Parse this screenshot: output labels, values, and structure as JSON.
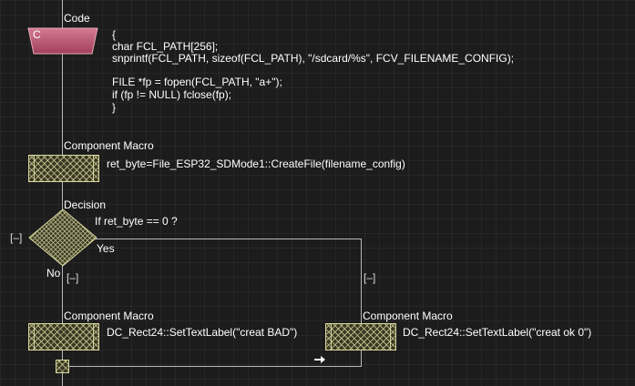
{
  "code_block": {
    "header": "Code",
    "icon_label": "C",
    "lines": [
      "{",
      "char FCL_PATH[256];",
      "snprintf(FCL_PATH, sizeof(FCL_PATH), \"/sdcard/%s\", FCV_FILENAME_CONFIG);",
      "",
      "FILE *fp = fopen(FCL_PATH, \"a+\");",
      "if (fp != NULL) fclose(fp);",
      "}"
    ]
  },
  "macro_create": {
    "header": "Component Macro",
    "call": "ret_byte=File_ESP32_SDMode1::CreateFile(filename_config)"
  },
  "decision": {
    "header": "Decision",
    "condition": "If  ret_byte == 0 ?",
    "yes_label": "Yes",
    "no_label": "No",
    "collapse_left": "[–]",
    "collapse_no": "[–]",
    "collapse_yes": "[–]"
  },
  "macro_bad": {
    "header": "Component Macro",
    "call": "DC_Rect24::SetTextLabel(\"creat BAD\")"
  },
  "macro_ok": {
    "header": "Component Macro",
    "call": "DC_Rect24::SetTextLabel(\"creat ok 0\")"
  },
  "colors": {
    "background": "#1c1c1c",
    "code_icon": "#b04a66",
    "hatch": "#d8d8a0",
    "connector": "#b8b8b8"
  }
}
